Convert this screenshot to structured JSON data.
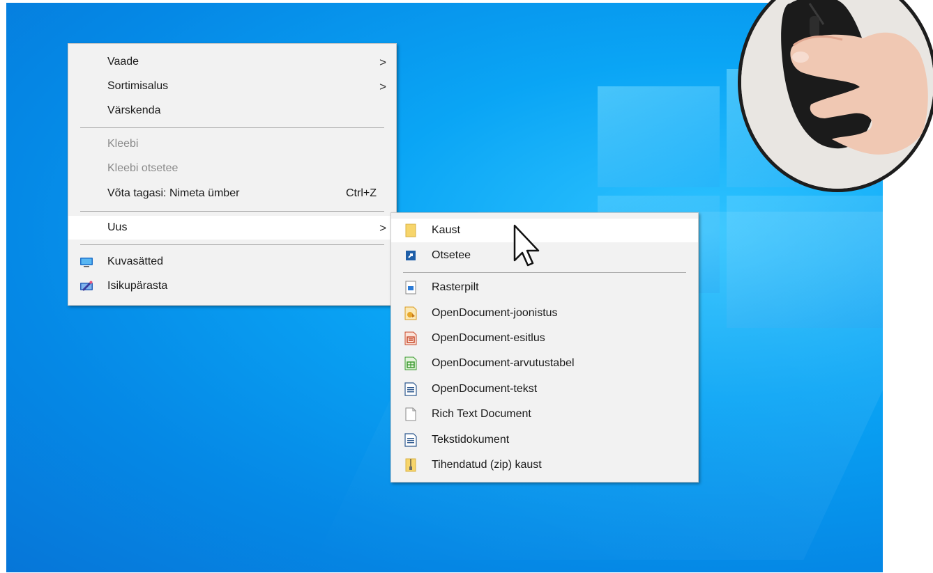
{
  "main_menu": {
    "items": [
      {
        "label": "Vaade",
        "submenu": true
      },
      {
        "label": "Sortimisalus",
        "submenu": true
      },
      {
        "label": "Värskenda"
      },
      {
        "label": "Kleebi",
        "disabled": true
      },
      {
        "label": "Kleebi otsetee",
        "disabled": true
      },
      {
        "label": "Võta tagasi: Nimeta ümber",
        "shortcut": "Ctrl+Z"
      },
      {
        "label": "Uus",
        "submenu": true,
        "active": true
      },
      {
        "label": "Kuvasätted",
        "icon": "display-settings-icon"
      },
      {
        "label": "Isikupärasta",
        "icon": "personalize-icon"
      }
    ]
  },
  "sub_menu": {
    "items": [
      {
        "label": "Kaust",
        "icon": "folder-icon",
        "hover": true
      },
      {
        "label": "Otsetee",
        "icon": "shortcut-icon"
      },
      {
        "label": "Rasterpilt",
        "icon": "bitmap-icon"
      },
      {
        "label": "OpenDocument-joonistus",
        "icon": "odg-icon"
      },
      {
        "label": "OpenDocument-esitlus",
        "icon": "odp-icon"
      },
      {
        "label": "OpenDocument-arvutustabel",
        "icon": "ods-icon"
      },
      {
        "label": "OpenDocument-tekst",
        "icon": "odt-icon"
      },
      {
        "label": "Rich Text Document",
        "icon": "rtf-icon"
      },
      {
        "label": "Tekstidokument",
        "icon": "txt-icon"
      },
      {
        "label": "Tihendatud (zip) kaust",
        "icon": "zip-folder-icon"
      }
    ]
  },
  "chevron_glyph": ">",
  "colors": {
    "desktop": "#0a9af0",
    "menu_bg": "#f2f2f2",
    "hover_bg": "#ffffff",
    "disabled_text": "#8a8a8a"
  }
}
